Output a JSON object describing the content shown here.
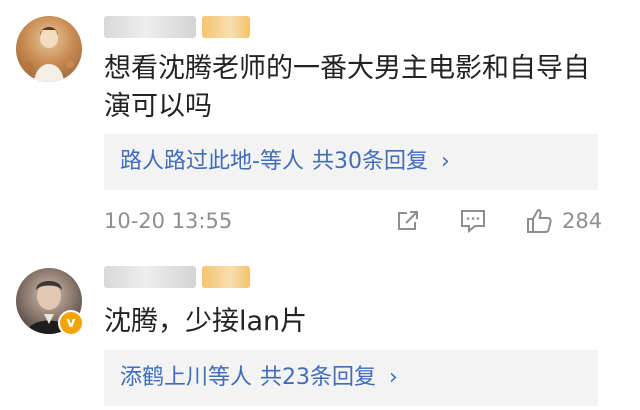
{
  "comments": [
    {
      "text": "想看沈腾老师的一番大男主电影和自导自演可以吗",
      "replies": {
        "who": "路人路过此地-等人",
        "total": "共30条回复",
        "chevron": "›"
      },
      "timestamp": "10-20 13:55",
      "likes": "284",
      "icons": [
        "share-icon",
        "comment-icon",
        "like-icon"
      ]
    },
    {
      "text": "沈腾，少接lan片",
      "verified": true,
      "verified_symbol": "v",
      "replies": {
        "who": "添鹤上川等人",
        "total": "共23条回复",
        "chevron": "›"
      }
    }
  ],
  "colors": {
    "link": "#3f6dbb",
    "meta": "#8e8e8e",
    "reply_bg": "#f3f3f3",
    "verified": "#f5a300"
  }
}
